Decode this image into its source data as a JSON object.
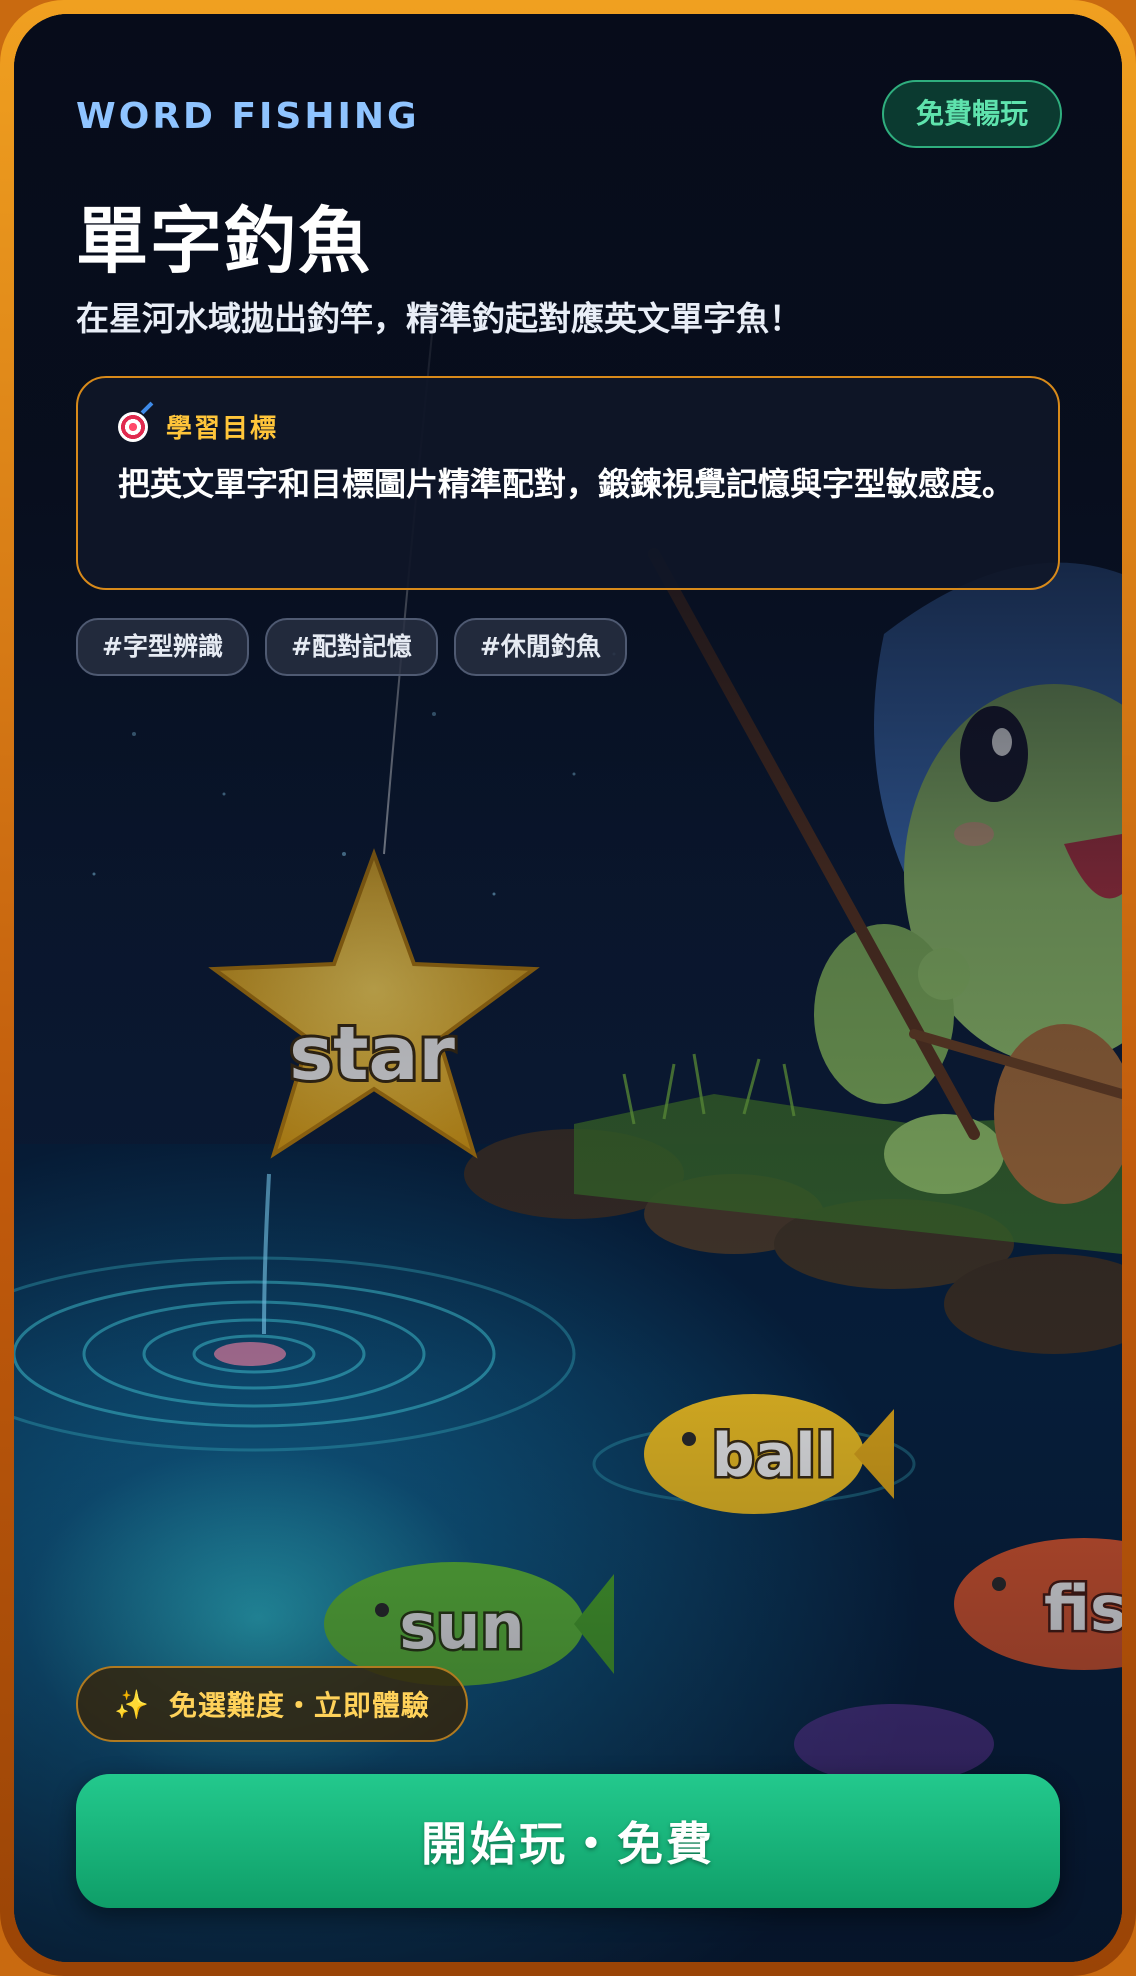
{
  "header": {
    "brand": "WORD FISHING",
    "free_badge": "免費暢玩",
    "title": "單字釣魚",
    "subtitle": "在星河水域拋出釣竿，精準釣起對應英文單字魚！"
  },
  "goal": {
    "icon": "target-icon",
    "label": "學習目標",
    "text": "把英文單字和目標圖片精準配對，鍛鍊視覺記憶與字型敏感度。"
  },
  "tags": [
    "#字型辨識",
    "#配對記憶",
    "#休閒釣魚"
  ],
  "scene": {
    "words": [
      "star",
      "ball",
      "sun",
      "fis"
    ]
  },
  "promo": {
    "icon": "sparkles-icon",
    "text": "免選難度・立即體驗"
  },
  "cta": {
    "label": "開始玩・免費"
  },
  "colors": {
    "accent_green": "#1fb87f",
    "accent_gold": "#ffc53a",
    "brand_blue": "#8fc4ff",
    "frame_orange": "#e08a18"
  }
}
